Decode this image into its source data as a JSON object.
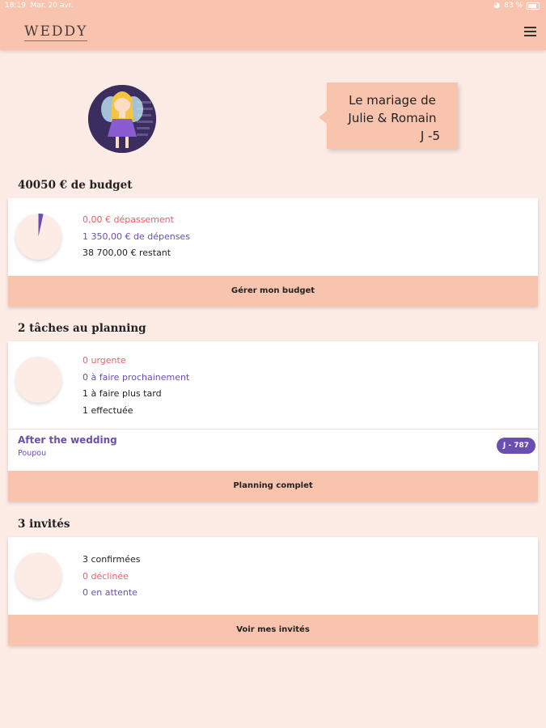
{
  "status_bar": {
    "time": "18:19",
    "date": "Mar. 20 avr.",
    "battery": "83 %"
  },
  "header": {
    "logo": "WEDDY"
  },
  "hero": {
    "title_line1": "Le mariage de",
    "title_line2": "Julie & Romain",
    "countdown": "J -5"
  },
  "budget": {
    "title": "40050 € de budget",
    "overrun": "0,00 € dépassement",
    "expenses": "1 350,00 € de dépenses",
    "remaining": "38 700,00 € restant",
    "spent_fraction": 0.034,
    "button": "Gérer mon budget"
  },
  "planning": {
    "title": "2 tâches au planning",
    "urgent": "0 urgente",
    "soon": "0 à faire prochainement",
    "later": "1 à faire plus tard",
    "done": "1 effectuée",
    "task": {
      "name": "After the wedding",
      "assignee": "Poupou",
      "badge": "J - 787"
    },
    "button": "Planning complet"
  },
  "guests": {
    "title": "3 invités",
    "confirmed": "3 confirmées",
    "declined": "0 déclinée",
    "pending": "0 en attente",
    "button": "Voir mes invités"
  },
  "colors": {
    "brand": "#f8c4ae",
    "background": "#fdebe6",
    "accent_purple": "#6a4fb0",
    "accent_red": "#ef5d6a"
  }
}
